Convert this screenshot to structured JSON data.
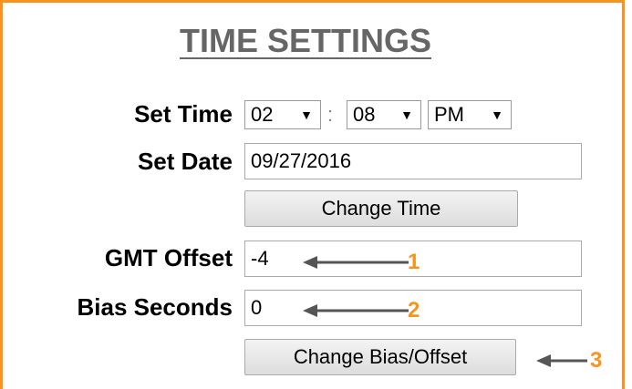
{
  "panel": {
    "title": "TIME SETTINGS",
    "accent_color": "#F7941D"
  },
  "time": {
    "label": "Set Time",
    "hour": "02",
    "separator": ":",
    "minute": "08",
    "ampm": "PM",
    "dropdown_icon": "▼"
  },
  "date": {
    "label": "Set Date",
    "value": "09/27/2016"
  },
  "change_time_button": "Change Time",
  "gmt": {
    "label": "GMT Offset",
    "value": "-4"
  },
  "bias": {
    "label": "Bias Seconds",
    "value": "0"
  },
  "change_bias_button": "Change Bias/Offset",
  "callouts": {
    "one": "1",
    "two": "2",
    "three": "3"
  }
}
